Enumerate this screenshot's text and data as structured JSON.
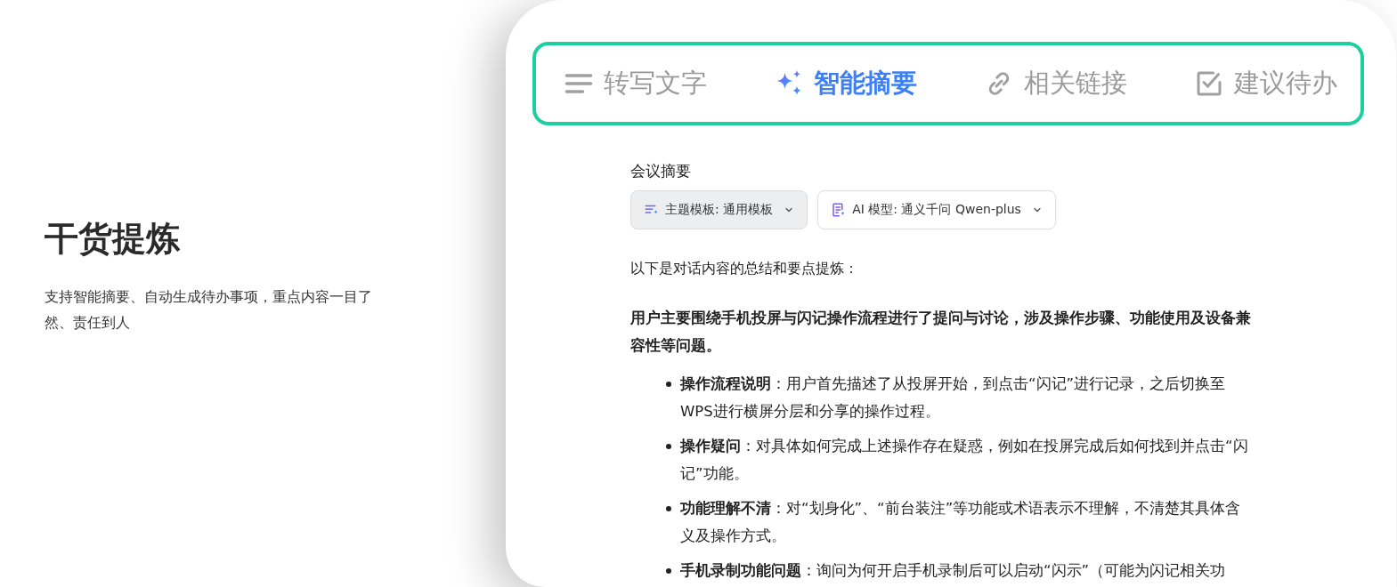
{
  "intro": {
    "title": "干货提炼",
    "description": "支持智能摘要、自动生成待办事项，重点内容一目了然、责任到人"
  },
  "tabs": [
    {
      "label": "转写文字",
      "selected": false
    },
    {
      "label": "智能摘要",
      "selected": true
    },
    {
      "label": "相关链接",
      "selected": false
    },
    {
      "label": "建议待办",
      "selected": false
    }
  ],
  "summary": {
    "heading": "会议摘要",
    "dropdowns": [
      {
        "label": "主题模板: 通用模板",
        "kind": "filled"
      },
      {
        "label": "AI 模型: 通义千问 Qwen-plus",
        "kind": "outlined"
      }
    ],
    "lead": "以下是对话内容的总结和要点提炼：",
    "overview": "用户主要围绕手机投屏与闪记操作流程进行了提问与讨论，涉及操作步骤、功能使用及设备兼容性等问题。",
    "points": [
      {
        "title": "操作流程说明",
        "text": "：用户首先描述了从投屏开始，到点击“闪记”进行记录，之后切换至WPS进行横屏分层和分享的操作过程。"
      },
      {
        "title": "操作疑问",
        "text": "：对具体如何完成上述操作存在疑惑，例如在投屏完成后如何找到并点击“闪记”功能。"
      },
      {
        "title": "功能理解不清",
        "text": "：对“划身化”、“前台装注”等功能或术语表示不理解，不清楚其具体含义及操作方式。"
      },
      {
        "title": "手机录制功能问题",
        "text": "：询问为何开启手机录制后可以启动“闪示”（可能为闪记相关功"
      }
    ]
  }
}
